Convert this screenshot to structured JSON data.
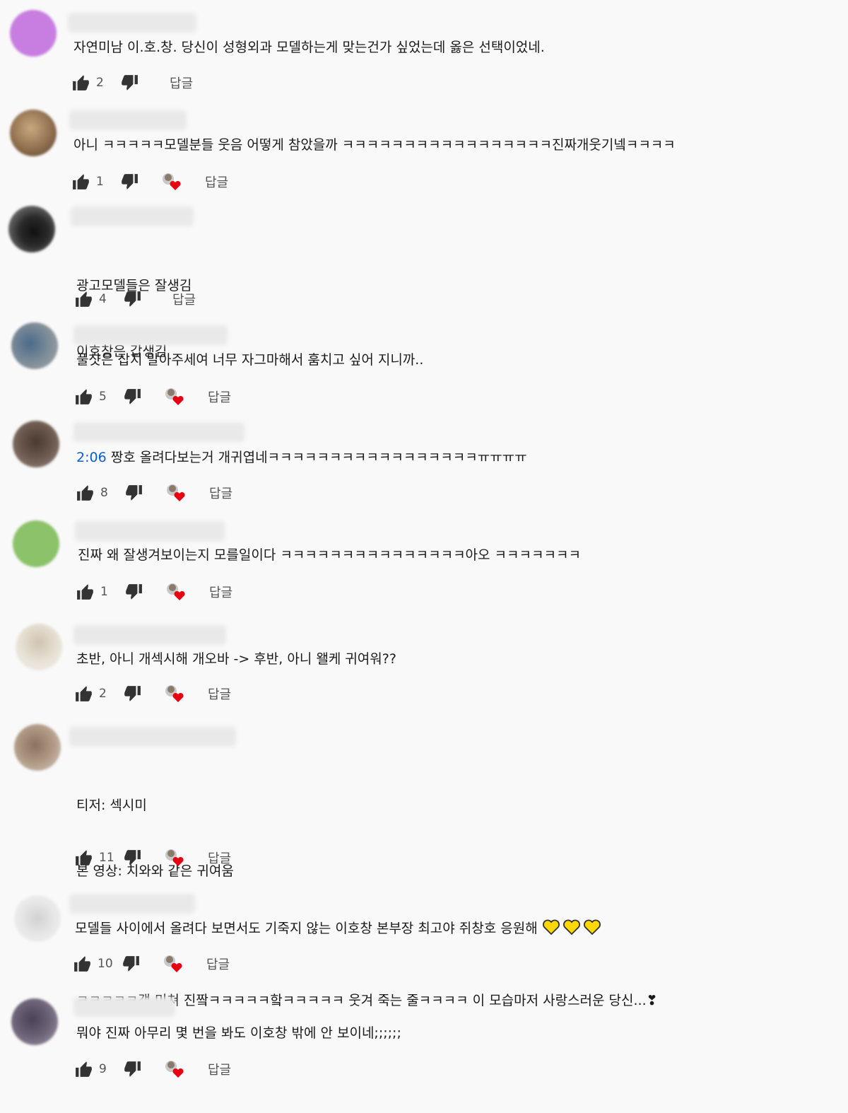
{
  "reply_label": "답글",
  "icons": {
    "like": "thumb-up-icon",
    "dislike": "thumb-down-icon",
    "hearted": "creator-heart-icon",
    "emoji": "yellow-heart-emoji"
  },
  "colors": {
    "background": "#f9f9f9",
    "timestamp": "#065fd4",
    "heart": "#e60012",
    "emoji_heart": "#ffd800"
  },
  "comments": [
    {
      "avatar_color": "#c77ee0",
      "text_lines": [
        "자연미남 이.호.창. 당신이 성형외과 모델하는게 맞는건가 싶었는데 옳은 선택이었네."
      ],
      "likes": "2",
      "hearted": false
    },
    {
      "avatar_color": "#a88a6c",
      "text_lines": [
        "아니 ㅋㅋㅋㅋㅋ모델분들 웃음 어떻게 참았을까 ㅋㅋㅋㅋㅋㅋㅋㅋㅋㅋㅋㅋㅋㅋㅋㅋㅋ진짜개웃기넼ㅋㅋㅋㅋ"
      ],
      "likes": "1",
      "hearted": true
    },
    {
      "avatar_color": "#3a3a3a",
      "text_lines": [
        "광고모델들은 잘생김",
        "이호창은 갑생김"
      ],
      "likes": "4",
      "hearted": false
    },
    {
      "avatar_color": "#7b8a99",
      "text_lines": [
        "풀샷은 잡지 말아주세여 너무 자그마해서 훔치고 싶어 지니까.."
      ],
      "likes": "5",
      "hearted": true
    },
    {
      "avatar_color": "#6d5a50",
      "timestamp": "2:06",
      "text_lines": [
        " 짱호 올려다보는거 개귀엽네ㅋㅋㅋㅋㅋㅋㅋㅋㅋㅋㅋㅋㅋㅋㅋㅋㅋㅠㅠㅠㅠ"
      ],
      "likes": "8",
      "hearted": true
    },
    {
      "avatar_color": "#8cc26a",
      "text_lines": [
        "진짜 왜 잘생겨보이는지 모를일이다 ㅋㅋㅋㅋㅋㅋㅋㅋㅋㅋㅋㅋㅋㅋㅋ아오 ㅋㅋㅋㅋㅋㅋㅋ"
      ],
      "likes": "1",
      "hearted": true
    },
    {
      "avatar_color": "#e8e2d6",
      "text_lines": [
        "초반, 아니 개섹시해 개오바 -> 후반, 아니 왤케 귀여워??"
      ],
      "likes": "2",
      "hearted": true
    },
    {
      "avatar_color": "#b09a86",
      "text_lines": [
        "티저: 섹시미",
        "본 영상: 치와와 같은 귀여움",
        "",
        "ㅋㅋㅋㅋㅋ갭 미쳐 진짴ㅋㅋㅋㅋㅋ핰ㅋㅋㅋㅋㅋ 웃겨 죽는 줄ㅋㅋㅋㅋ 이 모습마저 사랑스러운 당신...❣"
      ],
      "likes": "11",
      "hearted": true
    },
    {
      "avatar_color": "#e2e2e2",
      "text_lines": [
        "모델들 사이에서 올려다 보면서도 기죽지 않는 이호창 본부장 최고야 쥐창호 응원해 "
      ],
      "emoji_hearts": 3,
      "likes": "10",
      "hearted": true
    },
    {
      "avatar_color": "#6e6478",
      "text_lines": [
        "뭐야 진짜 아무리 몇 번을 봐도 이호창 밖에 안 보이네;;;;;;"
      ],
      "likes": "9",
      "hearted": true
    }
  ]
}
